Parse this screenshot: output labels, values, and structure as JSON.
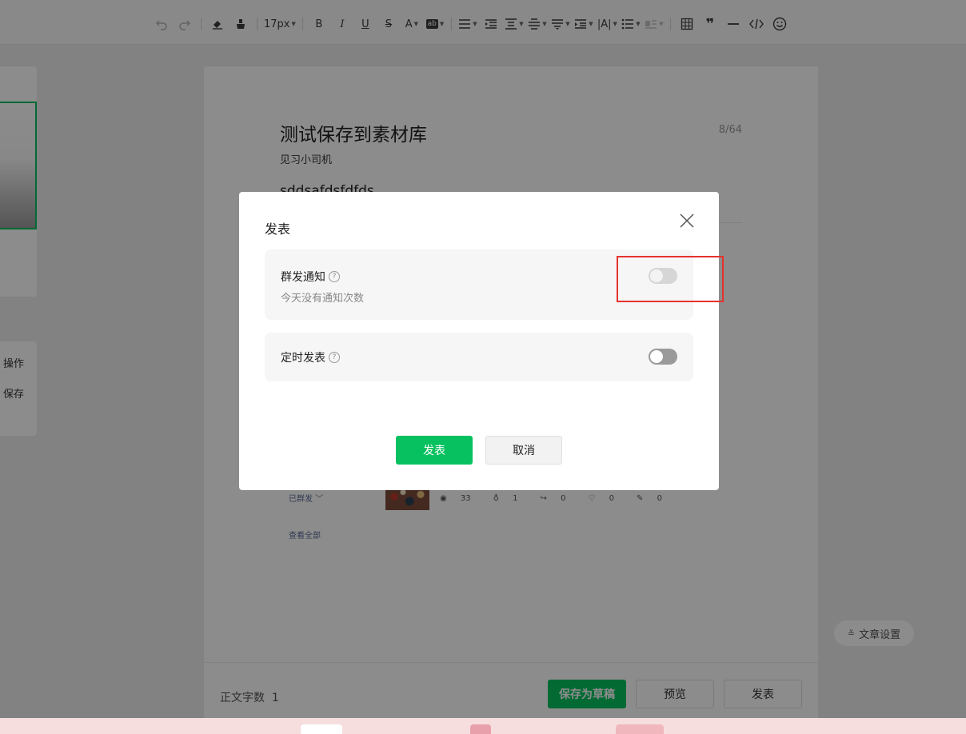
{
  "toolbar": {
    "font_size": "17px",
    "bold": "B",
    "italic": "I",
    "underline": "U",
    "strike": "S",
    "font_color": "A",
    "bg_color": "ab",
    "spacing": "|A|"
  },
  "left_panel": {
    "text_1": "操作",
    "text_2": "保存"
  },
  "article": {
    "title": "测试保存到素材库",
    "title_counter": "8/64",
    "author": "见习小司机",
    "body_snippet": "sddsafdsfdfds"
  },
  "history": {
    "status": "已群发",
    "views": "33",
    "likes": "1",
    "shares": "0",
    "favorites": "0",
    "comments": "0",
    "view_all": "查看全部"
  },
  "footer": {
    "word_count_label": "正文字数",
    "word_count_value": "1",
    "save_draft": "保存为草稿",
    "preview": "预览",
    "publish": "发表"
  },
  "article_settings": "文章设置",
  "modal": {
    "title": "发表",
    "option_1": {
      "label": "群发通知",
      "desc": "今天没有通知次数",
      "enabled": false
    },
    "option_2": {
      "label": "定时发表",
      "enabled": false
    },
    "help_glyph": "?",
    "publish_button": "发表",
    "cancel_button": "取消"
  },
  "colors": {
    "accent_green": "#07c160",
    "highlight_red": "#e5322d",
    "link_blue": "#576b95"
  }
}
